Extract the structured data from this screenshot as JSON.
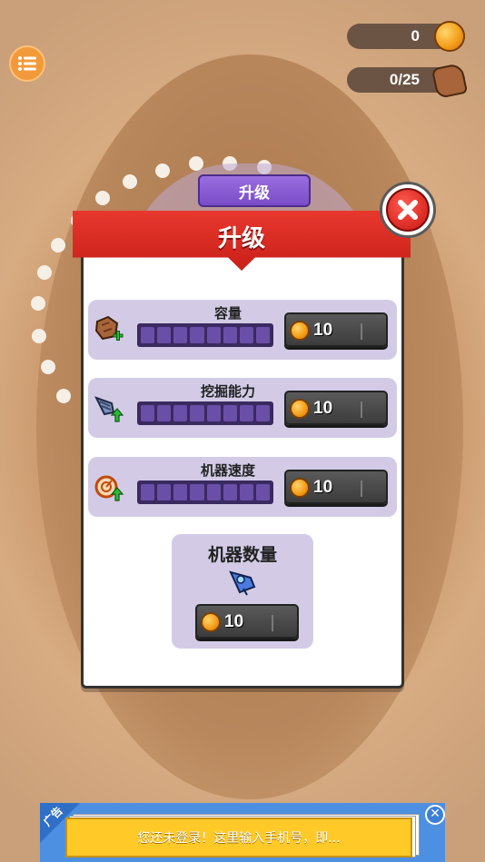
{
  "hud": {
    "coins": "0",
    "ore": "0/25"
  },
  "upgrade_tab_label": "升级",
  "panel": {
    "title": "升级",
    "rows": [
      {
        "label": "容量",
        "icon": "ore-plus-icon",
        "price": "10",
        "level": 0,
        "max_level": 8
      },
      {
        "label": "挖掘能力",
        "icon": "drill-up-icon",
        "price": "10",
        "level": 0,
        "max_level": 8
      },
      {
        "label": "机器速度",
        "icon": "speed-up-icon",
        "price": "10",
        "level": 0,
        "max_level": 8
      }
    ],
    "machines": {
      "title": "机器数量",
      "icon": "drill-robot-icon",
      "price": "10"
    }
  },
  "ad": {
    "corner_label": "广告",
    "message": "您还未登录！这里输入手机号，即..."
  },
  "colors": {
    "ribbon": "#d9261f",
    "panel_row": "#d3cbe6",
    "bar_bg": "#3a2a60",
    "button": "#4a4a4a",
    "coin": "#f5a21b",
    "ad_yellow": "#ffc928"
  }
}
